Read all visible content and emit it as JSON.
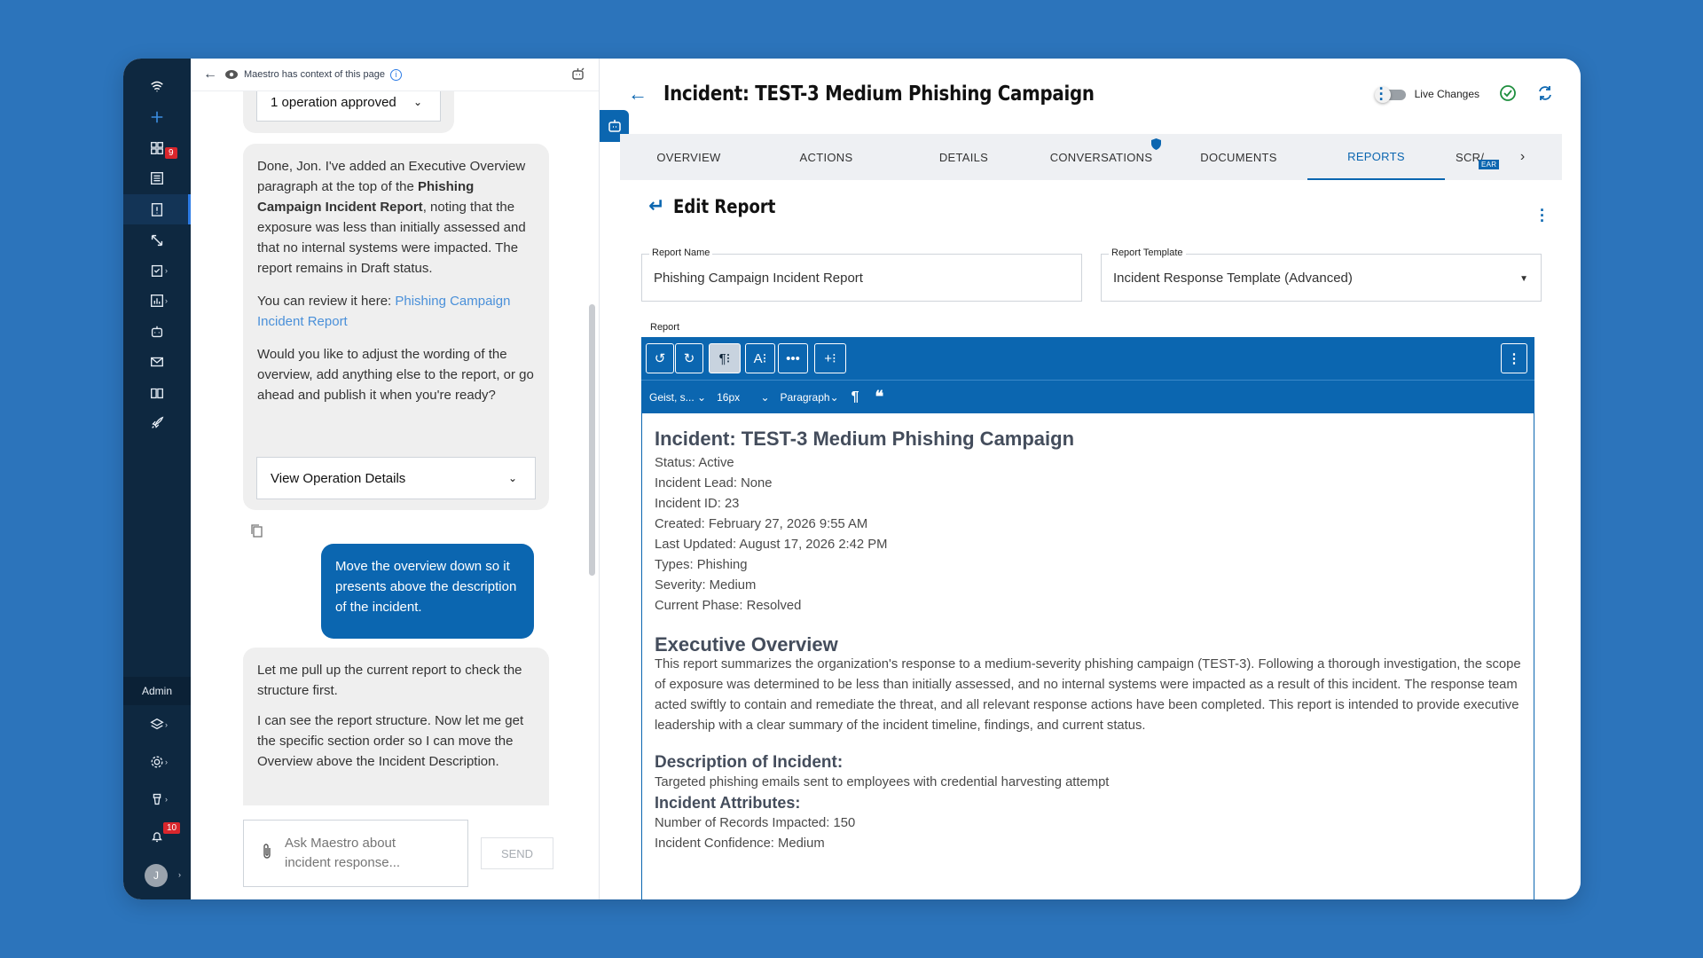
{
  "nav": {
    "items": [
      {
        "name": "logo-icon"
      },
      {
        "name": "add-icon"
      },
      {
        "name": "dashboard-icon"
      },
      {
        "name": "list-icon",
        "badge": "9"
      },
      {
        "name": "incident-icon",
        "active": true
      },
      {
        "name": "expand-icon"
      },
      {
        "name": "tasks-icon"
      },
      {
        "name": "reports-icon"
      },
      {
        "name": "bot-icon"
      },
      {
        "name": "mail-icon"
      },
      {
        "name": "book-icon"
      },
      {
        "name": "rocket-icon"
      }
    ],
    "admin_label": "Admin",
    "notifications_badge": "10",
    "avatar_initial": "J"
  },
  "chat": {
    "context_text": "Maestro has context of this page",
    "info_glyph": "i",
    "op_approved": "1 operation approved",
    "msg1_p1_a": "Done, Jon. I've added an Executive Overview paragraph at the top of the ",
    "msg1_p1_bold": "Phishing Campaign Incident Report",
    "msg1_p1_b": ", noting that the exposure was less than initially assessed and that no internal systems were impacted. The report remains in Draft status.",
    "msg1_p2": "You can review it here: ",
    "msg1_link": "Phishing Campaign Incident Report",
    "msg1_p3": "Would you like to adjust the wording of the overview, add anything else to the report, or go ahead and publish it when you're ready?",
    "view_op_details": "View Operation Details",
    "user_msg": "Move the overview down so it presents above the description of the incident.",
    "msg2_p1": "Let me pull up the current report to check the structure first.",
    "msg2_p2": "I can see the report structure. Now let me get the specific section order so I can move the Overview above the Incident Description.",
    "input_placeholder": "Ask Maestro about incident response...",
    "send_label": "SEND"
  },
  "header": {
    "title": "Incident: TEST-3 Medium Phishing Campaign",
    "live_changes": "Live Changes"
  },
  "tabs": [
    "OVERVIEW",
    "ACTIONS",
    "DETAILS",
    "CONVERSATIONS",
    "DOCUMENTS",
    "REPORTS",
    "SCR/"
  ],
  "tab_badge": "EAR",
  "edit": {
    "title": "Edit Report",
    "report_name_label": "Report Name",
    "report_name_value": "Phishing Campaign Incident Report",
    "template_label": "Report Template",
    "template_value": "Incident Response Template (Advanced)",
    "report_label": "Report"
  },
  "toolbar": {
    "font": "Geist, s...",
    "size": "16px",
    "block": "Paragraph"
  },
  "report": {
    "heading": "Incident: TEST-3 Medium Phishing Campaign",
    "fields": [
      "Status: Active",
      "Incident Lead: None",
      "Incident ID: 23",
      "Created: February 27, 2026 9:55 AM",
      "Last Updated: August 17, 2026 2:42 PM",
      "Types: Phishing",
      "Severity: Medium",
      "Current Phase: Resolved"
    ],
    "exec_heading": "Executive Overview",
    "exec_body": "This report summarizes the organization's response to a medium-severity phishing campaign (TEST-3). Following a thorough investigation, the scope of exposure was determined to be less than initially assessed, and no internal systems were impacted as a result of this incident. The response team acted swiftly to contain and remediate the threat, and all relevant response actions have been completed. This report is intended to provide executive leadership with a clear summary of the incident timeline, findings, and current status.",
    "desc_heading": "Description of Incident:",
    "desc_body": "Targeted phishing emails sent to employees with credential harvesting attempt",
    "attr_heading": "Incident Attributes:",
    "attr_1": "Number of Records Impacted: 150",
    "attr_2": "Incident Confidence: Medium"
  },
  "colors": {
    "accent": "#0b66b0",
    "nav_bg": "#0e2840",
    "page_bg": "#2c74bb",
    "badge": "#d9262c"
  }
}
